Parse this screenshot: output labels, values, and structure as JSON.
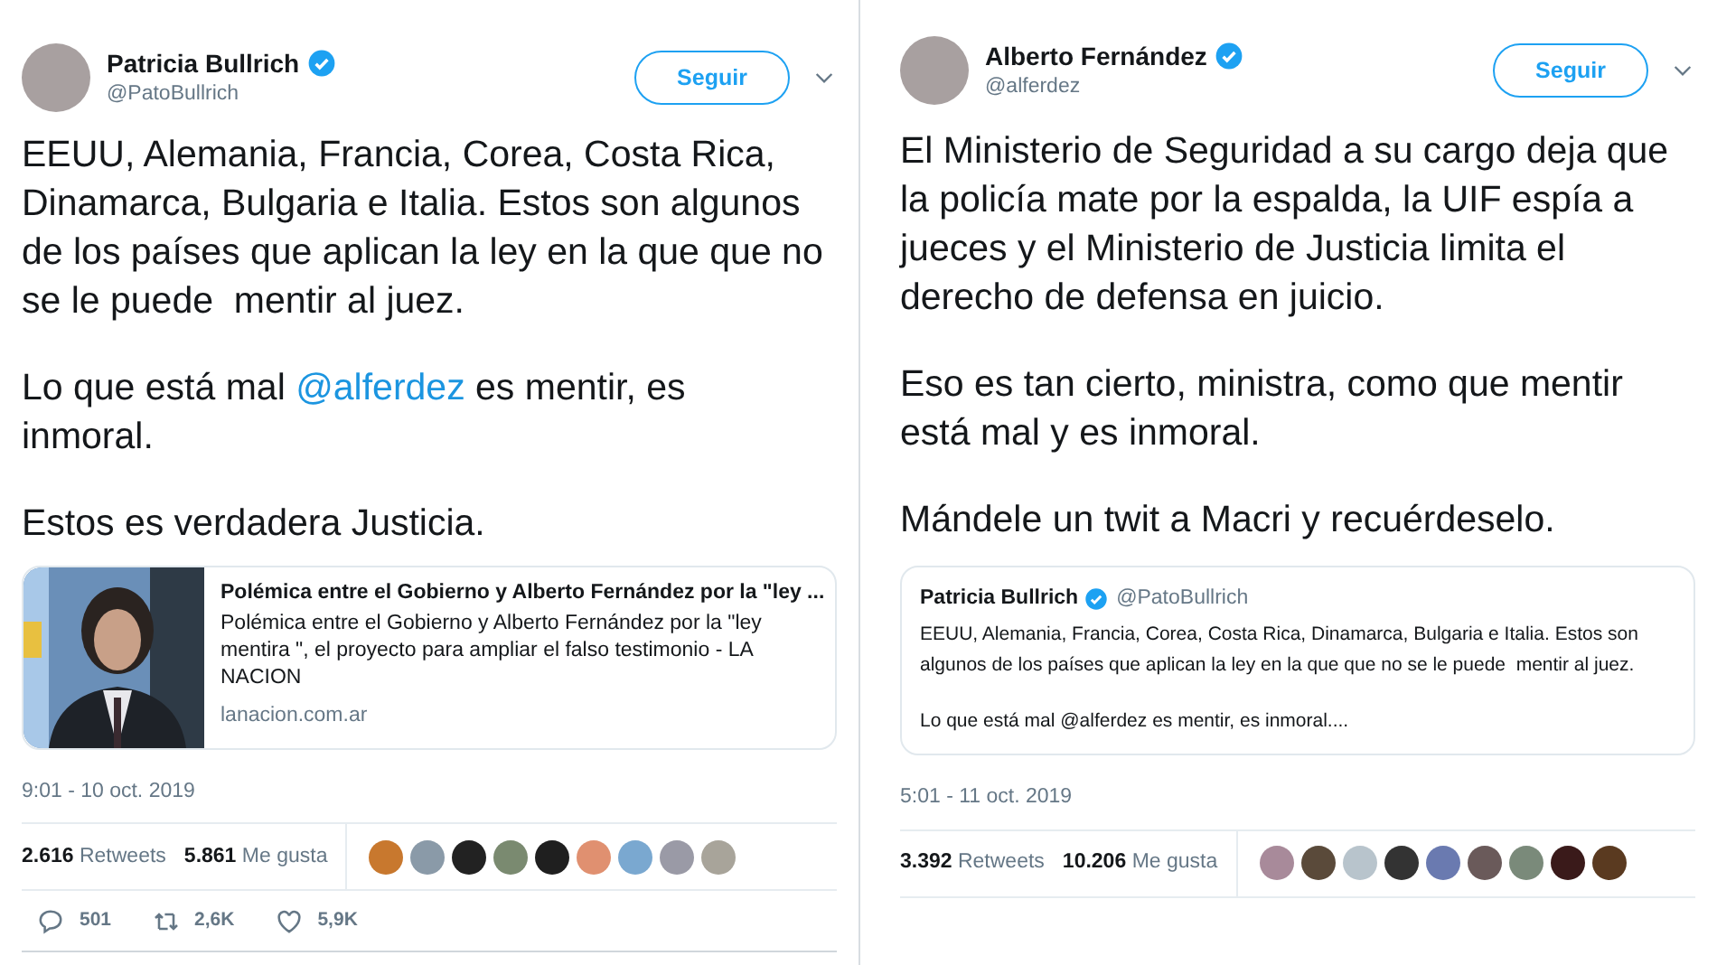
{
  "tweets": [
    {
      "author": {
        "name": "Patricia Bullrich",
        "handle": "@PatoBullrich",
        "verified": true
      },
      "follow_button": "Seguir",
      "paragraphs": [
        {
          "parts": [
            {
              "kind": "plain",
              "text": "EEUU, Alemania, Francia, Corea, Costa Rica, Dinamarca, Bulgaria e Italia. Estos son algunos de los países que aplican la ley en la que que no se le puede  mentir al juez."
            }
          ]
        },
        {
          "parts": [
            {
              "kind": "plain",
              "text": "Lo que está mal "
            },
            {
              "kind": "mention",
              "text": "@alferdez"
            },
            {
              "kind": "plain",
              "text": " es mentir, es inmoral."
            }
          ]
        },
        {
          "parts": [
            {
              "kind": "plain",
              "text": "Estos es verdadera Justicia."
            }
          ]
        }
      ],
      "attachment": {
        "kind": "link_card",
        "title": "Polémica entre el Gobierno y Alberto Fernández por la \"ley ...",
        "description": "Polémica entre el Gobierno y Alberto Fernández por la \"ley mentira \", el proyecto para ampliar el falso testimonio - LA NACION",
        "domain": "lanacion.com.ar"
      },
      "timestamp": "9:01 - 10 oct. 2019",
      "stats": {
        "retweets": "2.616",
        "retweets_label": "Retweets",
        "likes": "5.861",
        "likes_label": "Me gusta"
      },
      "likers": [
        {
          "color": "#c8782e"
        },
        {
          "color": "#8a9aa8"
        },
        {
          "color": "#222222"
        },
        {
          "color": "#7a8a70"
        },
        {
          "color": "#1f1f1f"
        },
        {
          "color": "#e09070"
        },
        {
          "color": "#7aa8d0"
        },
        {
          "color": "#9a9aa6"
        },
        {
          "color": "#a8a49a"
        }
      ],
      "actions": [
        {
          "kind": "reply",
          "count": "501"
        },
        {
          "kind": "retweet",
          "count": "2,6K"
        },
        {
          "kind": "like",
          "count": "5,9K"
        }
      ]
    },
    {
      "author": {
        "name": "Alberto Fernández",
        "handle": "@alferdez",
        "verified": true
      },
      "follow_button": "Seguir",
      "paragraphs": [
        {
          "parts": [
            {
              "kind": "plain",
              "text": "El Ministerio de Seguridad a su cargo deja que la policía mate por la espalda, la UIF espía a jueces y el Ministerio de Justicia limita el derecho de defensa en juicio."
            }
          ]
        },
        {
          "parts": [
            {
              "kind": "plain",
              "text": "Eso es tan cierto, ministra, como que mentir está mal y es inmoral."
            }
          ]
        },
        {
          "parts": [
            {
              "kind": "plain",
              "text": "Mándele un twit a Macri y recuérdeselo."
            }
          ]
        }
      ],
      "attachment": {
        "kind": "quote",
        "name": "Patricia Bullrich",
        "verified": true,
        "handle": "@PatoBullrich",
        "paragraphs": [
          "EEUU, Alemania, Francia, Corea, Costa Rica, Dinamarca, Bulgaria e Italia. Estos son algunos de los países que aplican la ley en la que que no se le puede  mentir al juez.",
          "Lo que está mal @alferdez es mentir, es inmoral...."
        ]
      },
      "timestamp": "5:01 - 11 oct. 2019",
      "stats": {
        "retweets": "3.392",
        "retweets_label": "Retweets",
        "likes": "10.206",
        "likes_label": "Me gusta"
      },
      "likers": [
        {
          "color": "#a88a9a"
        },
        {
          "color": "#5a4a3a"
        },
        {
          "color": "#b8c4cc"
        },
        {
          "color": "#333333"
        },
        {
          "color": "#6a7ab0"
        },
        {
          "color": "#6a5a5a"
        },
        {
          "color": "#7a8a7a"
        },
        {
          "color": "#3a1a1a"
        },
        {
          "color": "#5a3a20"
        }
      ]
    }
  ]
}
